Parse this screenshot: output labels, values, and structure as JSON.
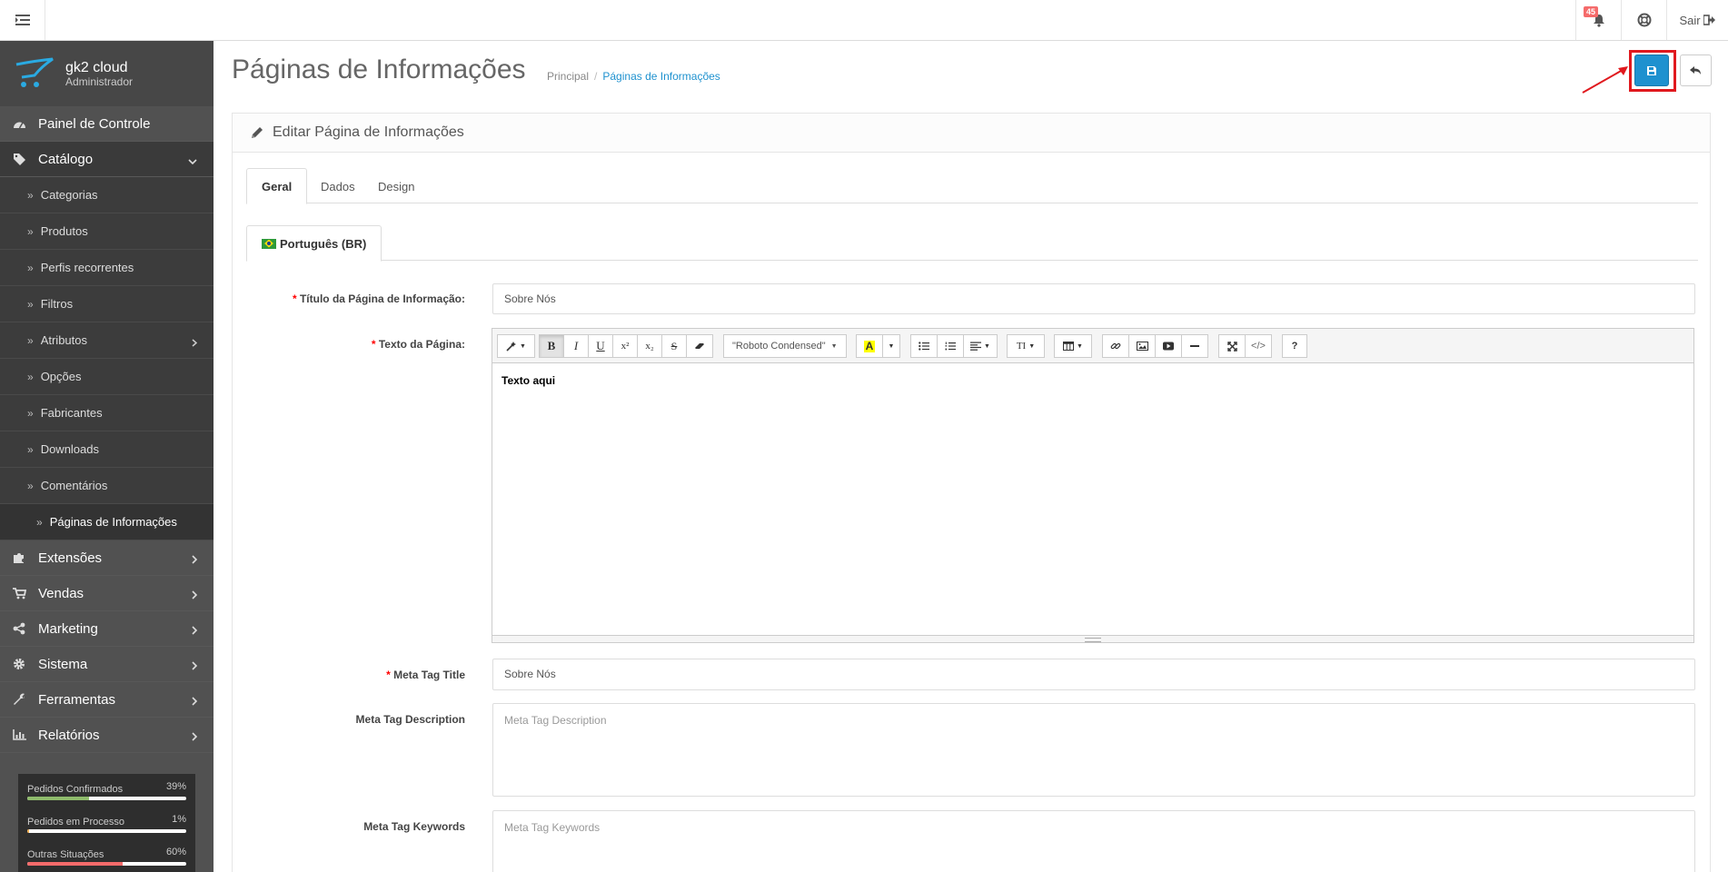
{
  "header": {
    "notif_badge": "45",
    "logout_label": "Sair"
  },
  "sidebar": {
    "profile_name": "gk2 cloud",
    "profile_role": "Administrador",
    "items": [
      {
        "label": "Painel de Controle",
        "icon": "dashboard-icon"
      },
      {
        "label": "Catálogo",
        "icon": "tags-icon"
      },
      {
        "label": "Extensões",
        "icon": "puzzle-icon"
      },
      {
        "label": "Vendas",
        "icon": "cart-icon"
      },
      {
        "label": "Marketing",
        "icon": "share-icon"
      },
      {
        "label": "Sistema",
        "icon": "gear-icon"
      },
      {
        "label": "Ferramentas",
        "icon": "wrench-icon"
      },
      {
        "label": "Relatórios",
        "icon": "bar-chart-icon"
      }
    ],
    "catalog_sub": [
      "Categorias",
      "Produtos",
      "Perfis recorrentes",
      "Filtros",
      "Atributos",
      "Opções",
      "Fabricantes",
      "Downloads",
      "Comentários",
      "Páginas de Informações"
    ],
    "stats": [
      {
        "label": "Pedidos Confirmados",
        "pct": "39%",
        "value": 39,
        "color": "#8fbb6c"
      },
      {
        "label": "Pedidos em Processo",
        "pct": "1%",
        "value": 1,
        "color": "#f0ad4e"
      },
      {
        "label": "Outras Situações",
        "pct": "60%",
        "value": 60,
        "color": "#f56b6b"
      }
    ]
  },
  "page": {
    "title": "Páginas de Informações",
    "breadcrumb_home": "Principal",
    "breadcrumb_current": "Páginas de Informações",
    "panel_title": "Editar Página de Informações"
  },
  "tabs": [
    "Geral",
    "Dados",
    "Design"
  ],
  "language_tab": "Português (BR)",
  "form": {
    "title_label": "Título da Página de Informação:",
    "title_value": "Sobre Nós",
    "text_label": "Texto da Página:",
    "editor_font": "\"Roboto Condensed\"",
    "editor_content": "Texto aqui",
    "meta_title_label": "Meta Tag Title",
    "meta_title_value": "Sobre Nós",
    "meta_desc_label": "Meta Tag Description",
    "meta_desc_placeholder": "Meta Tag Description",
    "meta_kw_label": "Meta Tag Keywords",
    "meta_kw_placeholder": "Meta Tag Keywords"
  },
  "colors": {
    "accent": "#1e91cf",
    "sidebar": "#515151",
    "annotation": "#e0191e"
  }
}
